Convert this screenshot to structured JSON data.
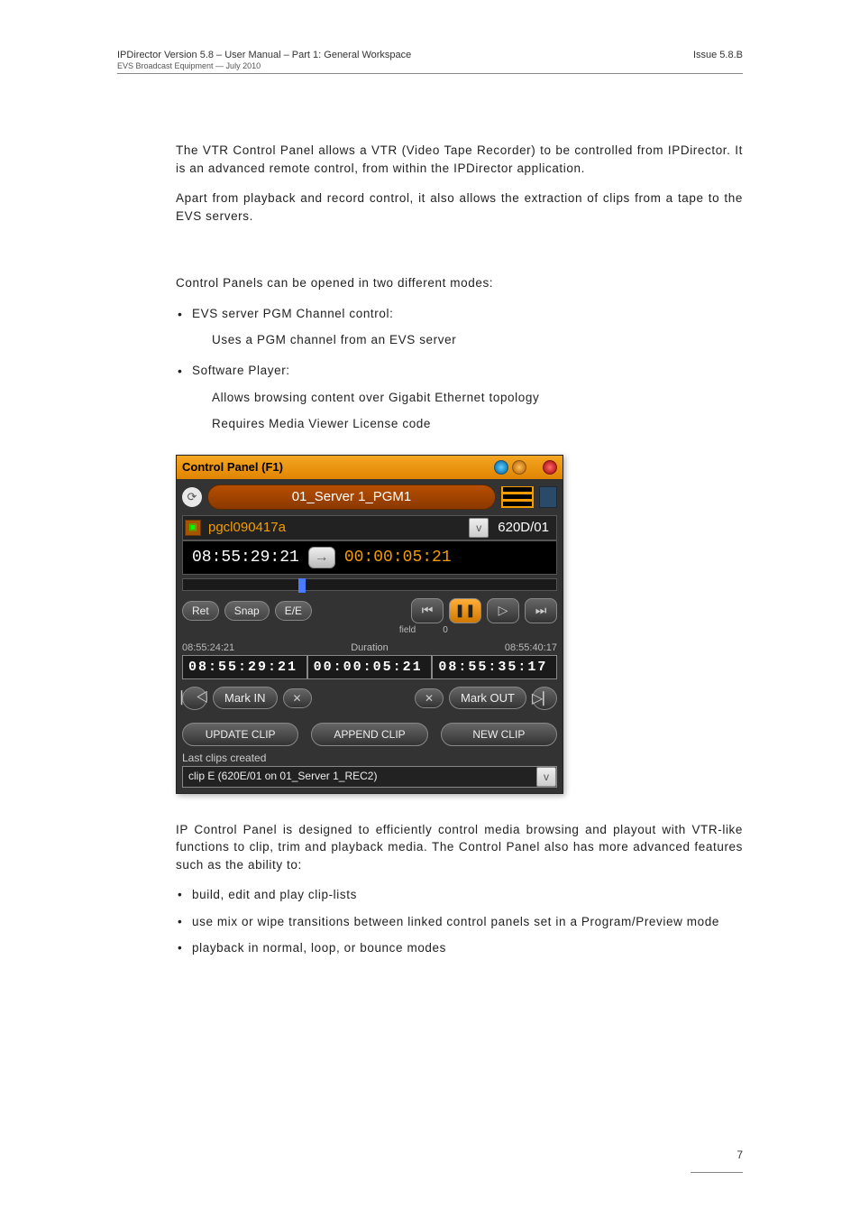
{
  "header": {
    "left_line1": "IPDirector Version 5.8 – User Manual – Part 1: General Workspace",
    "left_line2": "EVS Broadcast Equipment  —  July 2010",
    "right": "Issue 5.8.B"
  },
  "intro": {
    "p1": "The VTR Control Panel allows a VTR (Video Tape Recorder) to be controlled from IPDirector. It is an advanced remote control, from within the IPDirector application.",
    "p2": "Apart from playback and record control, it also allows the extraction of clips from a tape to the EVS servers."
  },
  "modes": {
    "lead": "Control Panels can be opened in two different modes:",
    "b1": "EVS server PGM Channel control:",
    "b1_sub": "Uses a PGM channel from an EVS server",
    "b2": "Software Player:",
    "b2_sub1": "Allows browsing content over Gigabit Ethernet topology",
    "b2_sub2": "Requires Media Viewer License code"
  },
  "cp": {
    "title": "Control Panel (F1)",
    "server": "01_Server 1_PGM1",
    "clip_name": "pgcl090417a",
    "clip_id": "620D/01",
    "tc_current": "08:55:29:21",
    "tc_dur": "00:00:05:21",
    "btn_ret": "Ret",
    "btn_snap": "Snap",
    "field_lbl": "field",
    "zero_lbl": "0",
    "small_left": "08:55:24:21",
    "small_mid": "Duration",
    "small_right": "08:55:40:17",
    "tc_in": "08:55:29:21",
    "tc_mid": "00:00:05:21",
    "tc_out": "08:55:35:17",
    "mark_in": "Mark IN",
    "mark_out": "Mark OUT",
    "update": "UPDATE CLIP",
    "append": "APPEND CLIP",
    "newclip": "NEW CLIP",
    "last_label": "Last clips created",
    "last_value": "clip E (620E/01 on 01_Server 1_REC2)"
  },
  "after": {
    "p1": "IP Control Panel is designed to efficiently control media browsing and playout with VTR-like functions to clip, trim and playback media. The Control Panel also has more advanced features such as the ability to:",
    "f1": "build, edit and play clip-lists",
    "f2": "use mix or wipe transitions between linked control panels set in a Program/Preview mode",
    "f3": "playback in normal, loop, or bounce modes"
  },
  "pagenum": "7"
}
